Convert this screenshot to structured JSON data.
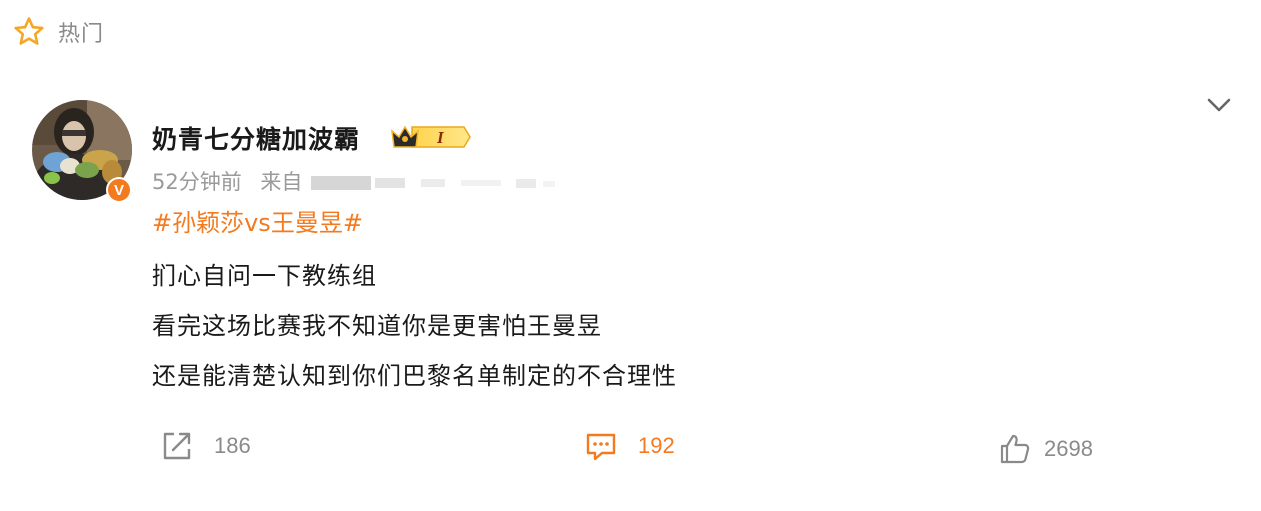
{
  "section": {
    "icon": "star-outline-icon",
    "label": "热门"
  },
  "post": {
    "author": {
      "name": "奶青七分糖加波霸",
      "avatar": "avatar-photo",
      "verified_badge": "V",
      "member_badge": "I"
    },
    "meta": {
      "time": "52分钟前",
      "source_prefix": "来自"
    },
    "topic": "#孙颖莎vs王曼昱#",
    "lines": [
      "扪心自问一下教练组",
      "看完这场比赛我不知道你是更害怕王曼昱",
      "还是能清楚认知到你们巴黎名单制定的不合理性"
    ],
    "actions": {
      "repost_count": "186",
      "comment_count": "192",
      "like_count": "2698"
    }
  },
  "colors": {
    "accent": "#f47a1f",
    "muted": "#8a8a8a",
    "text": "#1a1a1a"
  }
}
